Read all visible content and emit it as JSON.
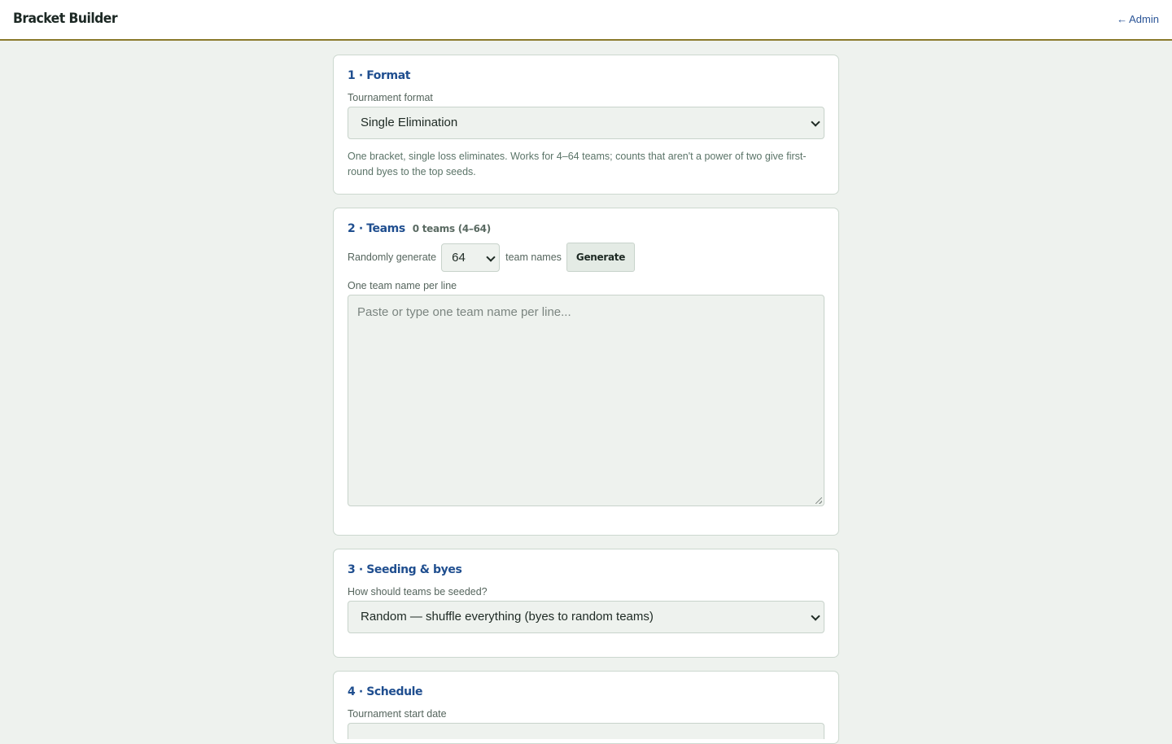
{
  "header": {
    "brand": "Bracket Builder",
    "admin_arrow": "←",
    "admin_label": "Admin"
  },
  "format": {
    "title": "1 · Format",
    "label": "Tournament format",
    "selected": "Single Elimination",
    "help": "One bracket, single loss eliminates. Works for 4–64 teams; counts that aren't a power of two give first-round byes to the top seeds."
  },
  "teams": {
    "title": "2 · Teams",
    "count_text": "0 teams (4–64)",
    "random_label": "Randomly generate",
    "random_count": "64",
    "random_suffix": "team names",
    "generate_label": "Generate",
    "list_label": "One team name per line",
    "placeholder": "Paste or type one team name per line..."
  },
  "seeding": {
    "title": "3 · Seeding & byes",
    "label": "How should teams be seeded?",
    "selected": "Random — shuffle everything (byes to random teams)"
  },
  "schedule": {
    "title": "4 · Schedule",
    "label": "Tournament start date"
  },
  "colors": {
    "accent": "#1f4e8f",
    "header_border": "#8a7a2c",
    "page_bg": "#eef2ee"
  }
}
